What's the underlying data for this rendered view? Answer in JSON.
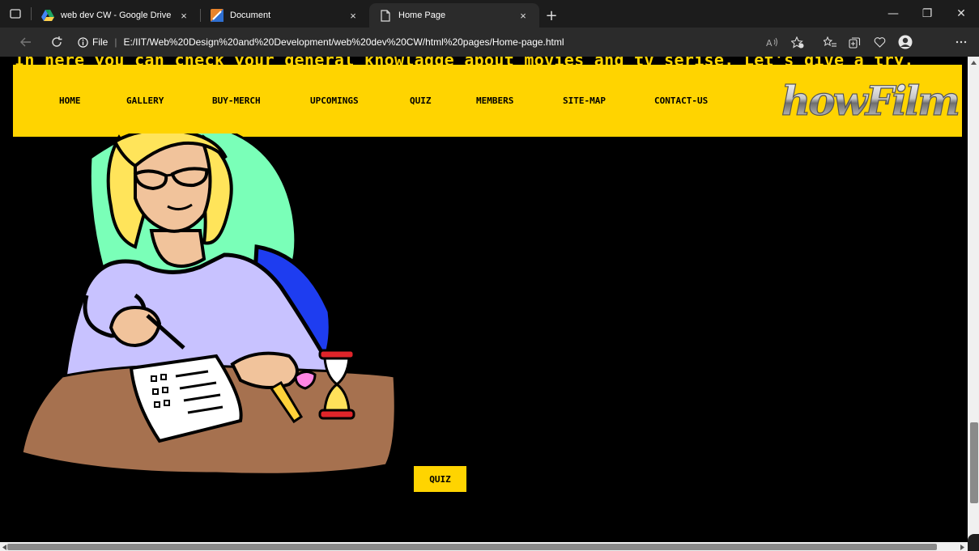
{
  "browser": {
    "tabs": [
      {
        "title": "web dev CW - Google Drive",
        "icon": "google-drive-icon",
        "close": "×"
      },
      {
        "title": "Document",
        "icon": "document-app-icon",
        "close": "×"
      },
      {
        "title": "Home Page",
        "icon": "page-icon",
        "close": "×",
        "active": true
      }
    ],
    "new_tab": "+",
    "window_controls": {
      "minimize": "—",
      "restore": "❐",
      "close": "✕"
    },
    "address": {
      "info_label": "File",
      "url": "E:/IIT/Web%20Design%20and%20Development/web%20dev%20CW/html%20pages/Home-page.html"
    }
  },
  "page": {
    "intro_text": "In here you can check your general knowladge about movies and tv serise. Let's give a try.",
    "nav": {
      "items": [
        "HOME",
        "GALLERY",
        "BUY-MERCH",
        "UPCOMINGS",
        "QUIZ",
        "MEMBERS",
        "SITE-MAP",
        "CONTACT-US"
      ]
    },
    "logo_text": "howFilm",
    "quiz_button": "QUIZ",
    "colors": {
      "accent": "#ffd400",
      "background": "#000000"
    }
  }
}
